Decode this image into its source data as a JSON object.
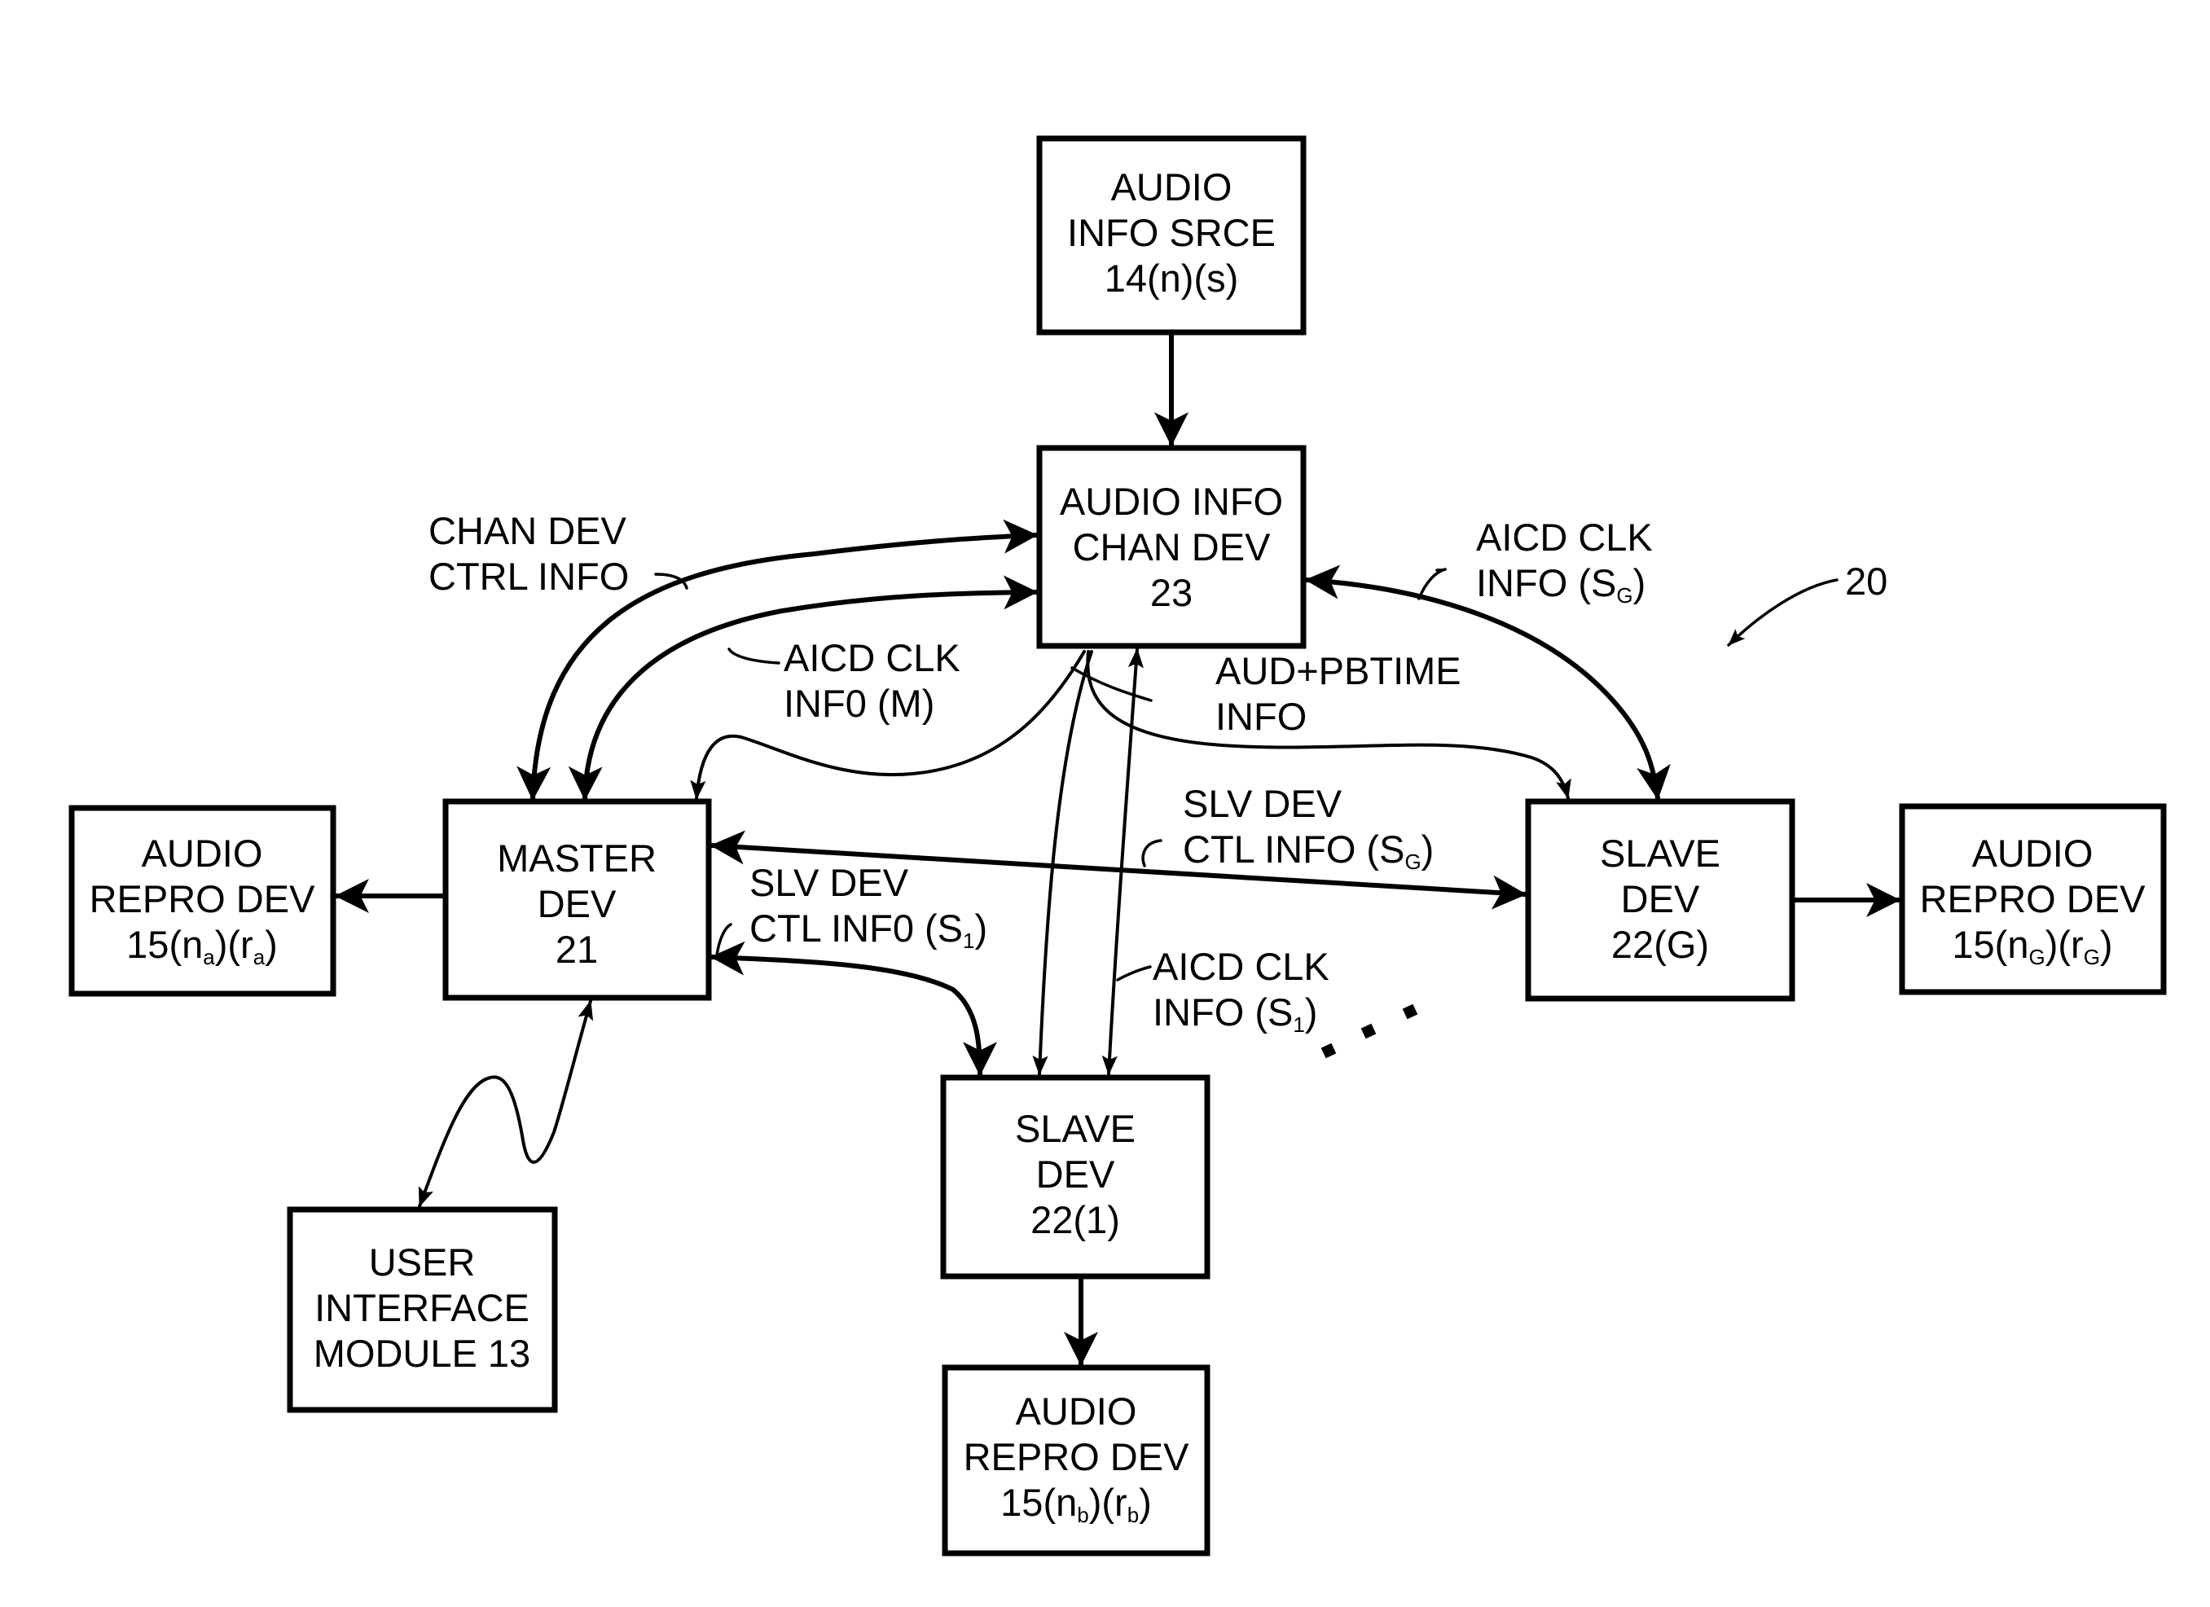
{
  "figure": {
    "reference_numeral": "20",
    "ellipsis": "..."
  },
  "boxes": {
    "audio_info_source": {
      "lines": [
        "AUDIO",
        "INFO SRCE",
        "14(n)(s)"
      ]
    },
    "audio_info_channel_device": {
      "lines": [
        "AUDIO INFO",
        "CHAN DEV",
        "23"
      ]
    },
    "master_device": {
      "lines": [
        "MASTER",
        "DEV",
        "21"
      ]
    },
    "slave_device_g": {
      "lines": [
        "SLAVE",
        "DEV",
        "22(G)"
      ]
    },
    "slave_device_1": {
      "lines": [
        "SLAVE",
        "DEV",
        "22(1)"
      ]
    },
    "user_interface_module": {
      "lines": [
        "USER",
        "INTERFACE",
        "MODULE 13"
      ]
    },
    "audio_repro_a": {
      "lines": [
        "AUDIO",
        "REPRO DEV"
      ],
      "id_prefix": "15(n",
      "n_sub": "a",
      "mid": ")(r",
      "r_sub": "a",
      "suffix": ")"
    },
    "audio_repro_g": {
      "lines": [
        "AUDIO",
        "REPRO DEV"
      ],
      "id_prefix": "15(n",
      "n_sub": "G",
      "mid": ")(r",
      "r_sub": "G",
      "suffix": ")"
    },
    "audio_repro_b": {
      "lines": [
        "AUDIO",
        "REPRO DEV"
      ],
      "id_prefix": "15(n",
      "n_sub": "b",
      "mid": ")(r",
      "r_sub": "b",
      "suffix": ")"
    }
  },
  "labels": {
    "chan_dev_ctrl_info": [
      "CHAN DEV",
      "CTRL INFO"
    ],
    "aicd_clk_info_m": [
      "AICD CLK",
      "INF0 (M)"
    ],
    "aicd_clk_info_sg": {
      "line1": "AICD CLK",
      "line2_prefix": "INFO (S",
      "line2_sub": "G",
      "line2_suffix": ")"
    },
    "aud_pbtime_info": [
      "AUD+PBTIME",
      "INFO"
    ],
    "slv_dev_ctl_info_sg": {
      "line1": "SLV DEV",
      "line2_prefix": "CTL INFO (S",
      "line2_sub": "G",
      "line2_suffix": ")"
    },
    "slv_dev_ctl_info_s1": {
      "line1": "SLV DEV",
      "line2_prefix": "CTL INF0 (S",
      "line2_sub": "1",
      "line2_suffix": ")"
    },
    "aicd_clk_info_s1": {
      "line1": "AICD CLK",
      "line2_prefix": "INFO (S",
      "line2_sub": "1",
      "line2_suffix": ")"
    }
  },
  "connections": [
    {
      "from": "audio_info_source",
      "to": "audio_info_channel_device",
      "direction": "one-way"
    },
    {
      "from": "audio_info_channel_device",
      "to": "master_device",
      "direction": "two-way",
      "label": "CHAN DEV CTRL INFO"
    },
    {
      "from": "audio_info_channel_device",
      "to": "master_device",
      "direction": "two-way",
      "label": "AICD CLK INF0 (M)"
    },
    {
      "from": "audio_info_channel_device",
      "to": "master_device",
      "direction": "one-way",
      "label": "AUD+PBTIME INFO"
    },
    {
      "from": "audio_info_channel_device",
      "to": "slave_device_g",
      "direction": "two-way",
      "label": "AICD CLK INFO (SG)"
    },
    {
      "from": "audio_info_channel_device",
      "to": "slave_device_g",
      "direction": "one-way",
      "label": "AUD+PBTIME INFO"
    },
    {
      "from": "audio_info_channel_device",
      "to": "slave_device_1",
      "direction": "one-way",
      "label": "AUD+PBTIME INFO"
    },
    {
      "from": "audio_info_channel_device",
      "to": "slave_device_1",
      "direction": "two-way",
      "label": "AICD CLK INFO (S1)"
    },
    {
      "from": "master_device",
      "to": "slave_device_g",
      "direction": "two-way",
      "label": "SLV DEV CTL INFO (SG)"
    },
    {
      "from": "master_device",
      "to": "slave_device_1",
      "direction": "two-way",
      "label": "SLV DEV CTL INF0 (S1)"
    },
    {
      "from": "master_device",
      "to": "audio_repro_a",
      "direction": "one-way"
    },
    {
      "from": "slave_device_g",
      "to": "audio_repro_g",
      "direction": "one-way"
    },
    {
      "from": "slave_device_1",
      "to": "audio_repro_b",
      "direction": "one-way"
    },
    {
      "from": "master_device",
      "to": "user_interface_module",
      "direction": "two-way"
    }
  ]
}
